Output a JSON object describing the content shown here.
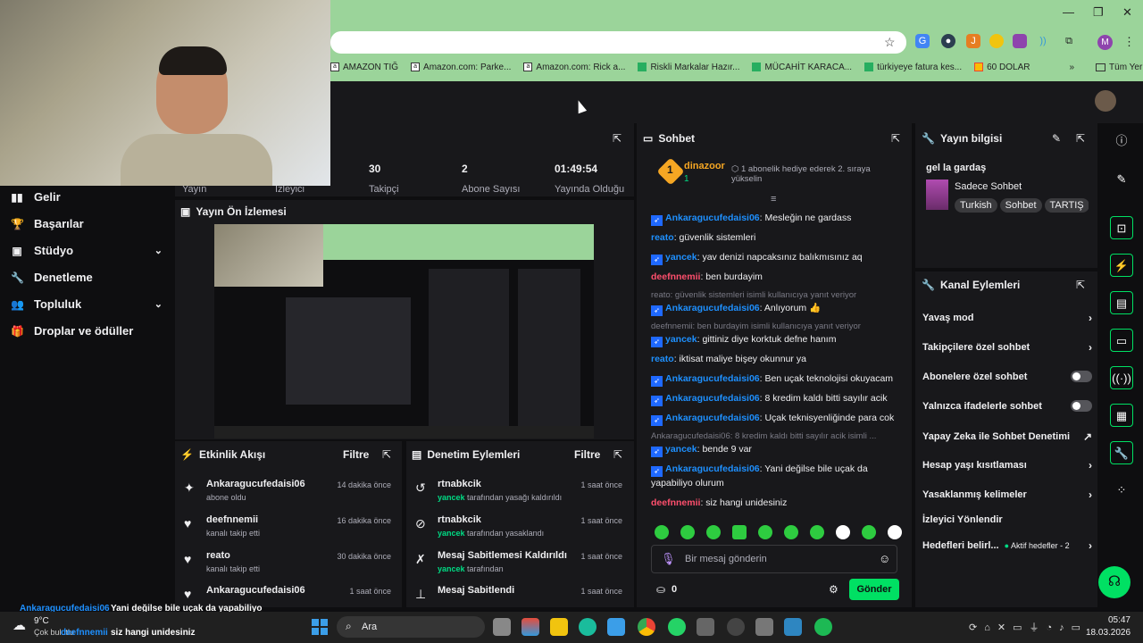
{
  "browser": {
    "bookmarks": [
      {
        "label": "AMAZON TIĞ",
        "icon": "amazon"
      },
      {
        "label": "Amazon.com: Parke...",
        "icon": "amazon"
      },
      {
        "label": "Amazon.com: Rick a...",
        "icon": "amazon"
      },
      {
        "label": "Riskli Markalar Hazır...",
        "icon": "sheets"
      },
      {
        "label": "MÜCAHİT KARACA...",
        "icon": "sheets"
      },
      {
        "label": "türkiyeye fatura kes...",
        "icon": "sheets"
      },
      {
        "label": "60 DOLAR",
        "icon": "apps"
      }
    ],
    "all_bookmarks": "Tüm Yer İşaretleri",
    "profile_initial": "M"
  },
  "leftnav": {
    "items": [
      {
        "label": "Gelir",
        "icon": "chart-icon",
        "chevron": false
      },
      {
        "label": "Başarılar",
        "icon": "trophy-icon",
        "chevron": false
      },
      {
        "label": "Stüdyo",
        "icon": "camera-icon",
        "chevron": true
      },
      {
        "label": "Denetleme",
        "icon": "wrench-icon",
        "chevron": false
      },
      {
        "label": "Topluluk",
        "icon": "people-icon",
        "chevron": true
      },
      {
        "label": "Droplar ve ödüller",
        "icon": "gift-icon",
        "chevron": false
      }
    ]
  },
  "stats": [
    {
      "value": "",
      "label": "Yayın"
    },
    {
      "value": "",
      "label": "İzleyici"
    },
    {
      "value": "30",
      "label": "Takipçi"
    },
    {
      "value": "2",
      "label": "Abone Sayısı"
    },
    {
      "value": "01:49:54",
      "label": "Yayında Olduğu"
    }
  ],
  "preview": {
    "title": "Yayın Ön İzlemesi"
  },
  "activity": {
    "title": "Etkinlik Akışı",
    "filter": "Filtre",
    "items": [
      {
        "name": "Ankaragucufedaisi06",
        "sub": "abone oldu",
        "time": "14 dakika önce",
        "icon": "sparkle-icon"
      },
      {
        "name": "deefnnemii",
        "sub": "kanalı takip etti",
        "time": "16 dakika önce",
        "icon": "heart-icon"
      },
      {
        "name": "reato",
        "sub": "kanalı takip etti",
        "time": "30 dakika önce",
        "icon": "heart-icon"
      },
      {
        "name": "Ankaragucufedaisi06",
        "sub": "",
        "time": "1 saat önce",
        "icon": "heart-icon"
      }
    ]
  },
  "moderation": {
    "title": "Denetim Eylemleri",
    "filter": "Filtre",
    "items": [
      {
        "name": "rtnabkcik",
        "actor": "yancek",
        "sub": "tarafından yasağı kaldırıldı",
        "time": "1 saat önce",
        "icon": "undo-icon"
      },
      {
        "name": "rtnabkcik",
        "actor": "yancek",
        "sub": "tarafından yasaklandı",
        "time": "1 saat önce",
        "icon": "ban-icon"
      },
      {
        "name": "Mesaj Sabitlemesi Kaldırıldı",
        "actor": "yancek",
        "sub": "tarafından",
        "time": "1 saat önce",
        "icon": "unpin-icon"
      },
      {
        "name": "Mesaj Sabitlendi",
        "actor": "",
        "sub": "",
        "time": "1 saat önce",
        "icon": "pin-icon"
      }
    ]
  },
  "chat": {
    "title": "Sohbet",
    "hype": {
      "rank": "1",
      "user": "dinazoor",
      "count": "1",
      "text": "1 abonelik hediye ederek 2. sıraya yükselin"
    },
    "messages": [
      {
        "type": "msg",
        "user": "Ankaragucufedaisi06",
        "color": "blue",
        "badge": true,
        "text": ": Mesleğin ne gardass"
      },
      {
        "type": "msg",
        "user": "reato",
        "color": "blue",
        "badge": false,
        "text": ": güvenlik sistemleri"
      },
      {
        "type": "msg",
        "user": "yancek",
        "color": "blue",
        "badge": true,
        "text": ": yav denizi napcaksınız balıkmısınız aq"
      },
      {
        "type": "msg",
        "user": "deefnnemii",
        "color": "red",
        "badge": false,
        "text": ": ben burdayim"
      },
      {
        "type": "reply",
        "text": "reato: güvenlik sistemleri isimli kullanıcıya yanıt veriyor"
      },
      {
        "type": "msg",
        "user": "Ankaragucufedaisi06",
        "color": "blue",
        "badge": true,
        "text": ": Anlıyorum 👍"
      },
      {
        "type": "reply",
        "text": "deefnnemii: ben burdayim isimli kullanıcıya yanıt veriyor"
      },
      {
        "type": "msg",
        "user": "yancek",
        "color": "blue",
        "badge": true,
        "text": ": gittiniz diye korktuk defne hanım"
      },
      {
        "type": "msg",
        "user": "reato",
        "color": "blue",
        "badge": false,
        "text": ": iktisat maliye bişey okunnur ya"
      },
      {
        "type": "msg",
        "user": "Ankaragucufedaisi06",
        "color": "blue",
        "badge": true,
        "text": ": Ben uçak teknolojisi okuyacam"
      },
      {
        "type": "msg",
        "user": "Ankaragucufedaisi06",
        "color": "blue",
        "badge": true,
        "text": ": 8 kredim kaldı bitti sayılır acik"
      },
      {
        "type": "msg",
        "user": "Ankaragucufedaisi06",
        "color": "blue",
        "badge": true,
        "text": ": Uçak teknisyenliğinde para cok"
      },
      {
        "type": "reply",
        "text": "Ankaragucufedaisi06: 8 kredim kaldı bitti sayılır acik isimli ..."
      },
      {
        "type": "msg",
        "user": "yancek",
        "color": "blue",
        "badge": true,
        "text": ": bende 9 var"
      },
      {
        "type": "msg",
        "user": "Ankaragucufedaisi06",
        "color": "blue",
        "badge": true,
        "text": ": Yani değilse bile uçak da yapabiliyo olurum"
      },
      {
        "type": "msg",
        "user": "deefnnemii",
        "color": "red",
        "badge": false,
        "text": ": siz hangi unidesiniz"
      }
    ],
    "input_placeholder": "Bir mesaj gönderin",
    "points": "0",
    "send_label": "Gönder"
  },
  "info": {
    "title": "Yayın bilgisi",
    "stream_title": "gel la gardaş",
    "category": "Sadece Sohbet",
    "tags": [
      "Turkish",
      "Sohbet",
      "TARTIŞ"
    ]
  },
  "actions": {
    "title": "Kanal Eylemleri",
    "items": [
      {
        "label": "Yavaş mod",
        "kind": "chevron"
      },
      {
        "label": "Takipçilere özel sohbet",
        "kind": "chevron"
      },
      {
        "label": "Abonelere özel sohbet",
        "kind": "toggle"
      },
      {
        "label": "Yalnızca ifadelerle sohbet",
        "kind": "toggle"
      },
      {
        "label": "Yapay Zeka ile Sohbet Denetimi",
        "kind": "external"
      },
      {
        "label": "Hesap yaşı kısıtlaması",
        "kind": "chevron"
      },
      {
        "label": "Yasaklanmış kelimeler",
        "kind": "chevron"
      },
      {
        "label": "İzleyici Yönlendir",
        "kind": "none"
      },
      {
        "label": "Hedefleri belirl...",
        "kind": "goal",
        "extra": "Aktif hedefler - 2"
      }
    ]
  },
  "overlay": {
    "line1_user": "Ankaragucufedaisi06",
    "line1_text": "Yani değilse bile uçak da yapabiliyo",
    "line2_text": "olurum",
    "line3_user": "deefnnemii",
    "line3_text": "siz hangi unidesiniz"
  },
  "taskbar": {
    "weather_temp": "9°C",
    "weather_desc": "Çok bulutlu",
    "search": "Ara",
    "time": "05:47",
    "date": "18.03.2026"
  },
  "colors": {
    "accent": "#00e063",
    "purple": "#9147ff",
    "username_blue": "#1e90ff",
    "username_red": "#ff4f6d"
  }
}
